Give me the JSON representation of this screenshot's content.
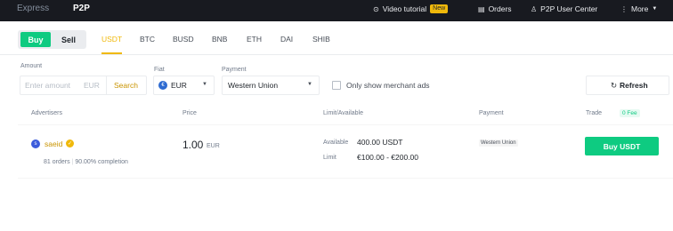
{
  "topbar": {
    "tabs": [
      "Express",
      "P2P"
    ],
    "video_tutorial": "Video tutorial",
    "new_badge": "New",
    "orders": "Orders",
    "user_center": "P2P User Center",
    "more": "More"
  },
  "trade": {
    "buy": "Buy",
    "sell": "Sell",
    "coins": [
      "USDT",
      "BTC",
      "BUSD",
      "BNB",
      "ETH",
      "DAI",
      "SHIB"
    ]
  },
  "filters": {
    "amount_label": "Amount",
    "amount_placeholder": "Enter amount",
    "amount_currency": "EUR",
    "search": "Search",
    "fiat_label": "Fiat",
    "fiat_value": "EUR",
    "fiat_icon_letter": "€",
    "payment_label": "Payment",
    "payment_value": "Western Union",
    "merchant_only": "Only show merchant ads",
    "refresh": "Refresh"
  },
  "table": {
    "headers": [
      "Advertisers",
      "Price",
      "Limit/Available",
      "Payment",
      "Trade"
    ],
    "fee_badge": "0 Fee",
    "rows": [
      {
        "avatar_letter": "s",
        "name": "saeid",
        "orders": "81 orders",
        "completion": "90.00% completion",
        "price": "1.00",
        "price_currency": "EUR",
        "available_label": "Available",
        "available_value": "400.00 USDT",
        "limit_label": "Limit",
        "limit_value": "€100.00 - €200.00",
        "payment": "Western Union",
        "action": "Buy USDT"
      }
    ]
  },
  "colors": {
    "accent": "#f0b90b",
    "buy_green": "#0ecb81",
    "topbar_bg": "#181a20"
  }
}
